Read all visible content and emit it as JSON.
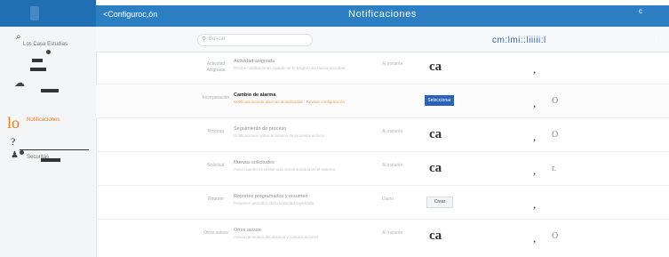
{
  "topbar": {
    "back_label": "<Configuroc,ón",
    "title": "Notificaciones",
    "right_text": "c"
  },
  "search": {
    "placeholder": "Buscar"
  },
  "search_strip": {
    "lib_text": "cm:lmi::liiiii:l",
    "tag": "( )"
  },
  "sidebar": {
    "items": [
      {
        "label": "Los Casa Estudias"
      },
      {
        "label": "Notificaciones"
      },
      {
        "label": "Securitas"
      }
    ],
    "accent_text": "lo",
    "mark_text": "?"
  },
  "rows": [
    {
      "category": "Actividad Asignada",
      "title": "Actividad asignada",
      "description": "Recibe notificaciones cuando se te asigna una nueva actividad",
      "frequency": "Al instante",
      "action": "ca",
      "comma": ",",
      "tail": ""
    },
    {
      "category": "Incorporación",
      "title": "Cambio de alarma",
      "description": "Notificaciones de alarmas actualizadas · Revisar configuración",
      "frequency": "",
      "action": "Seleccionar",
      "comma": ",",
      "tail": "O"
    },
    {
      "category": "Proceso",
      "title": "Seguimiento de proceso",
      "description": "Notificaciones sobre el avance de procesos activos",
      "frequency": "Al instante",
      "action": "ca",
      "comma": ",",
      "tail": "O"
    },
    {
      "category": "Solicitud",
      "title": "Nuevas solicitudes",
      "description": "Aviso cuando se recibe una nueva solicitud en el sistema",
      "frequency": "Al instante",
      "action": "ca",
      "comma": ",",
      "tail": "r."
    },
    {
      "category": "Reporte",
      "title": "Reportes programados y resumen",
      "description": "Resumen periódico de la actividad registrada",
      "frequency": "Diario",
      "action": "Crear",
      "comma": ",",
      "tail": ""
    },
    {
      "category": "Otros avisos",
      "title": "Otros avisos",
      "description": "Avisos generales del sistema y comunicaciones",
      "frequency": "Al instante",
      "action": "ca",
      "comma": ",",
      "tail": "O"
    }
  ],
  "colors": {
    "topbar": "#2c7fc3",
    "accent": "#e57c1f",
    "button": "#2c63b8"
  }
}
